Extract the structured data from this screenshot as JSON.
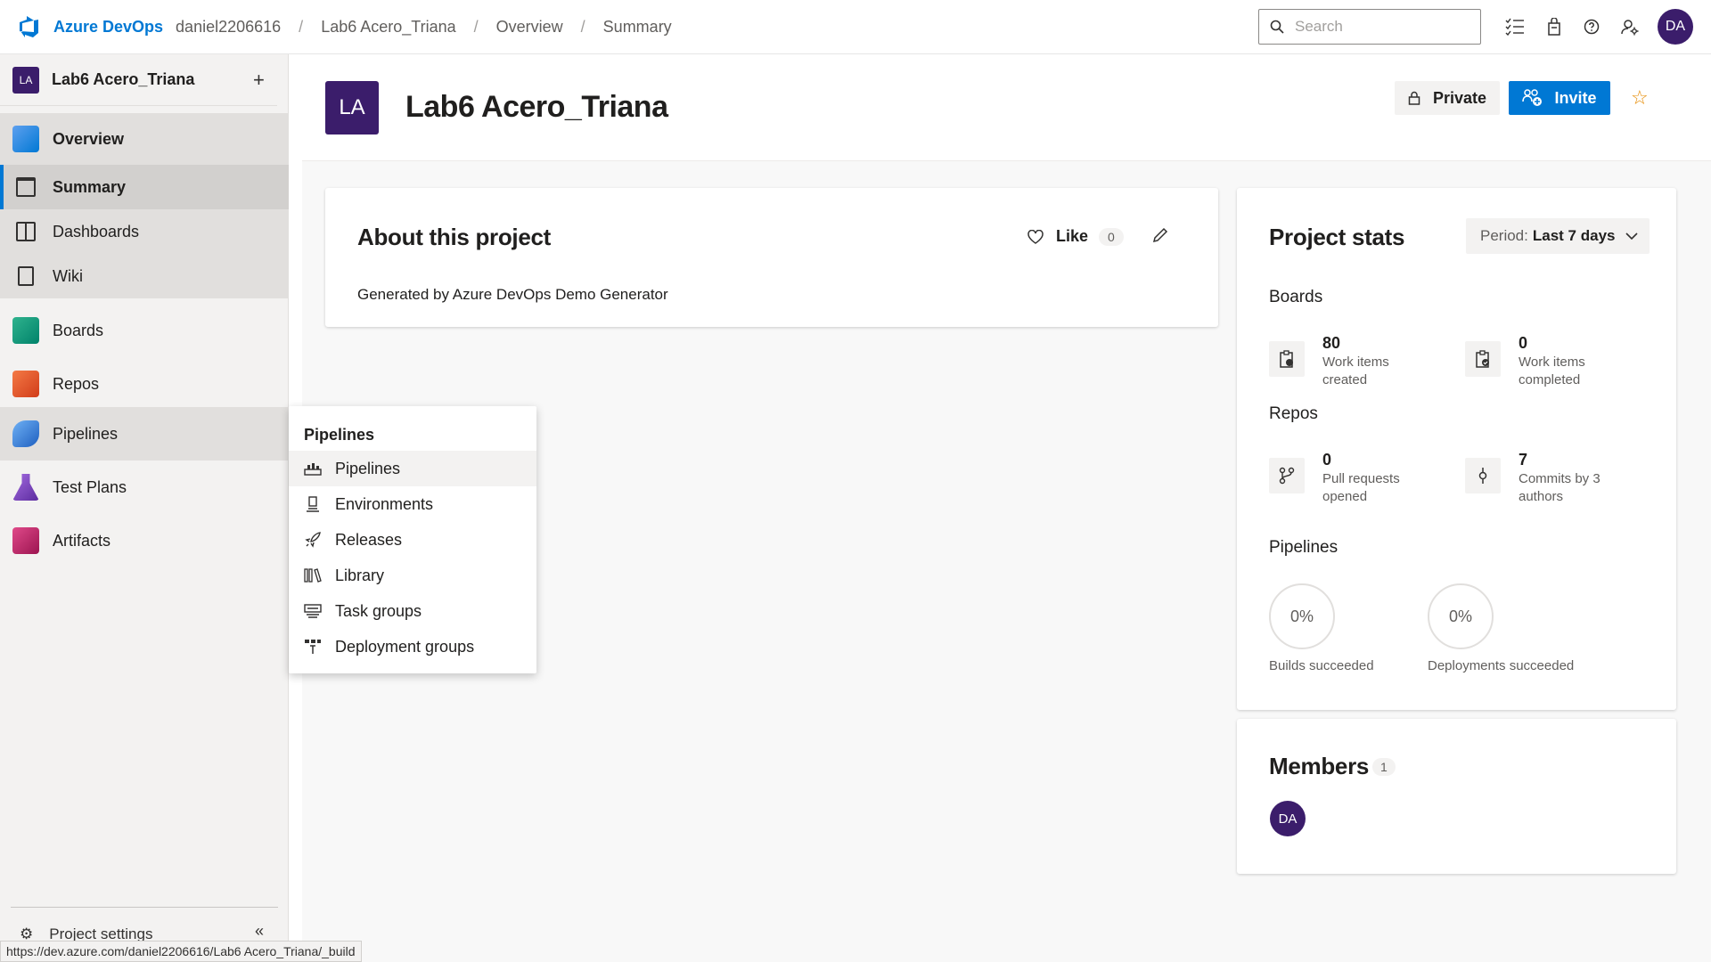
{
  "topbar": {
    "brand": "Azure DevOps",
    "breadcrumbs": [
      "daniel2206616",
      "Lab6 Acero_Triana",
      "Overview",
      "Summary"
    ],
    "search_placeholder": "Search",
    "user_initials": "DA"
  },
  "sidebar": {
    "project_initials": "LA",
    "project_name": "Lab6 Acero_Triana",
    "items": [
      {
        "label": "Overview",
        "icon": "overview-icon",
        "color": "#0078d4"
      },
      {
        "label": "Summary",
        "icon": "summary-icon"
      },
      {
        "label": "Dashboards",
        "icon": "dashboards-icon"
      },
      {
        "label": "Wiki",
        "icon": "wiki-icon"
      },
      {
        "label": "Boards",
        "icon": "boards-icon",
        "color": "#009c7a"
      },
      {
        "label": "Repos",
        "icon": "repos-icon",
        "color": "#e05f2d"
      },
      {
        "label": "Pipelines",
        "icon": "pipelines-icon",
        "color": "#2b78d4"
      },
      {
        "label": "Test Plans",
        "icon": "test-plans-icon",
        "color": "#7b3fbf"
      },
      {
        "label": "Artifacts",
        "icon": "artifacts-icon",
        "color": "#c2185b"
      }
    ],
    "project_settings": "Project settings"
  },
  "header": {
    "initials": "LA",
    "title": "Lab6 Acero_Triana",
    "private_label": "Private",
    "invite_label": "Invite"
  },
  "about": {
    "title": "About this project",
    "like_label": "Like",
    "like_count": "0",
    "description": "Generated by Azure DevOps Demo Generator"
  },
  "stats": {
    "title": "Project stats",
    "period_prefix": "Period:",
    "period_value": "Last 7 days",
    "boards_title": "Boards",
    "work_items_created": "80",
    "work_items_created_label": "Work items created",
    "work_items_completed": "0",
    "work_items_completed_label": "Work items completed",
    "repos_title": "Repos",
    "pull_requests": "0",
    "pull_requests_label": "Pull requests opened",
    "commits": "7",
    "commits_label": "Commits by 3 authors",
    "pipelines_title": "Pipelines",
    "builds_pct": "0%",
    "builds_label": "Builds succeeded",
    "deployments_pct": "0%",
    "deployments_label": "Deployments succeeded"
  },
  "members": {
    "title": "Members",
    "count": "1",
    "avatar_initials": "DA"
  },
  "flyout": {
    "title": "Pipelines",
    "items": [
      "Pipelines",
      "Environments",
      "Releases",
      "Library",
      "Task groups",
      "Deployment groups"
    ]
  },
  "statusbar": {
    "url": "https://dev.azure.com/daniel2206616/Lab6 Acero_Triana/_build"
  }
}
